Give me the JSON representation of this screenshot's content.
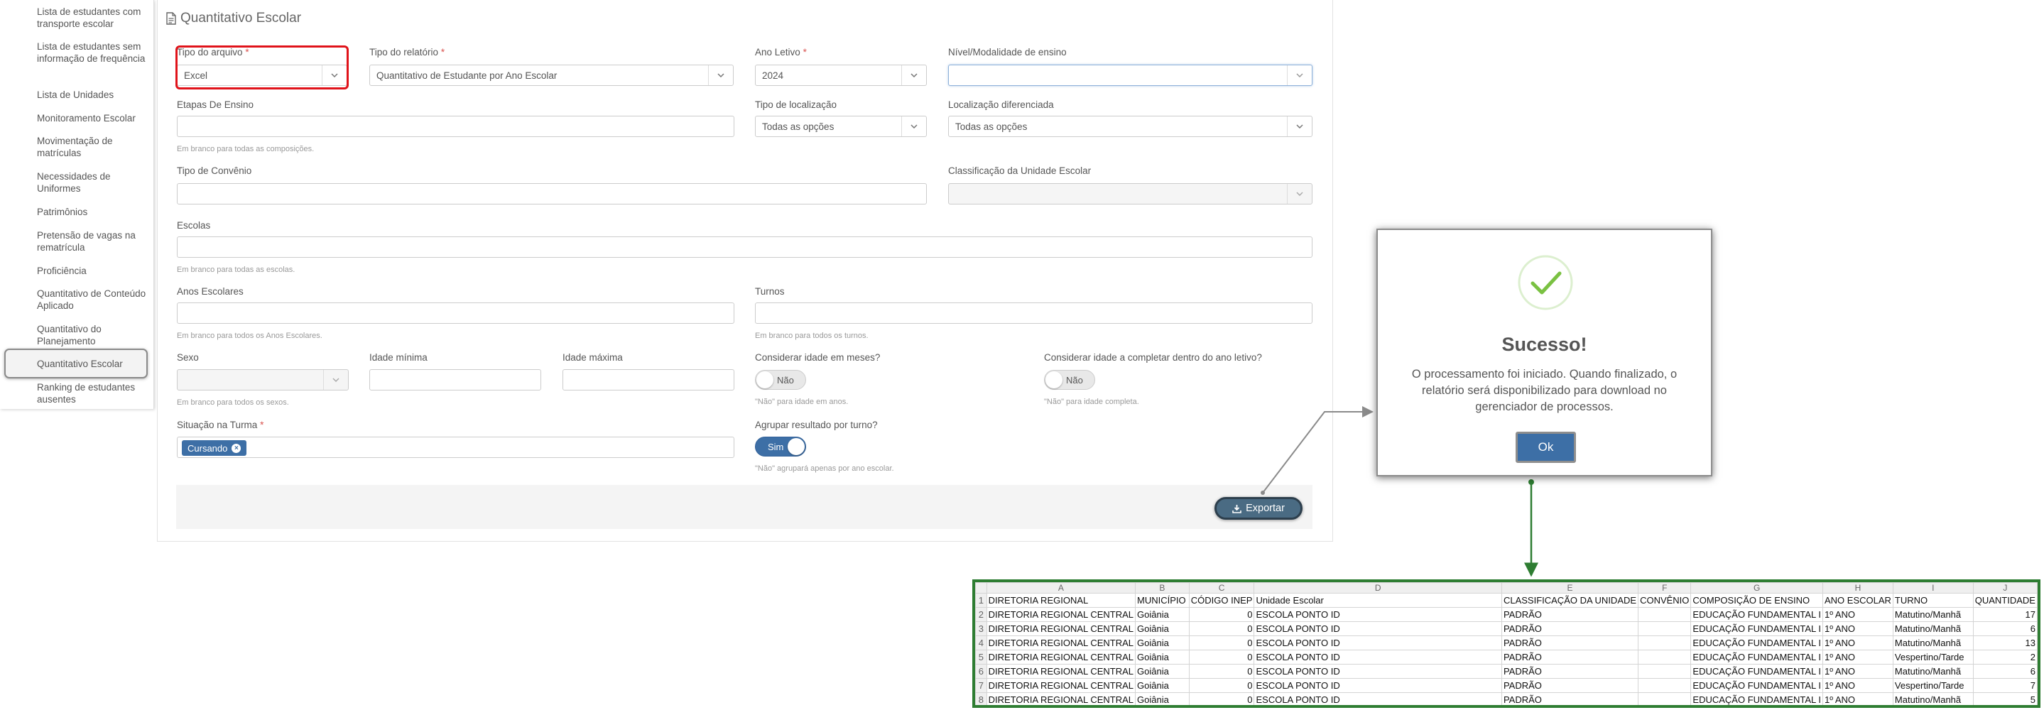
{
  "sidebar": {
    "items": [
      {
        "label": "Lista de estudantes com transporte escolar"
      },
      {
        "label": "Lista de estudantes sem informação de frequência"
      },
      {
        "label": "Lista de Unidades"
      },
      {
        "label": "Monitoramento Escolar"
      },
      {
        "label": "Movimentação de matrículas"
      },
      {
        "label": "Necessidades de Uniformes"
      },
      {
        "label": "Patrimônios"
      },
      {
        "label": "Pretensão de vagas na rematrícula"
      },
      {
        "label": "Proficiência"
      },
      {
        "label": "Quantitativo de Conteúdo Aplicado"
      },
      {
        "label": "Quantitativo do Planejamento"
      },
      {
        "label": "Quantitativo Escolar"
      },
      {
        "label": "Ranking de estudantes ausentes"
      }
    ],
    "active": "Quantitativo Escolar"
  },
  "page": {
    "title": "Quantitativo Escolar"
  },
  "form": {
    "required_mark": "*",
    "tipo_arquivo": {
      "label": "Tipo do arquivo",
      "value": "Excel"
    },
    "tipo_relatorio": {
      "label": "Tipo do relatório",
      "value": "Quantitativo de Estudante por Ano Escolar"
    },
    "ano_letivo": {
      "label": "Ano Letivo",
      "value": "2024"
    },
    "nivel": {
      "label": "Nível/Modalidade de ensino",
      "value": ""
    },
    "etapas": {
      "label": "Etapas De Ensino",
      "hint": "Em branco para todas as composições."
    },
    "tipo_localizacao": {
      "label": "Tipo de localização",
      "value": "Todas as opções"
    },
    "localizacao_diferenciada": {
      "label": "Localização diferenciada",
      "value": "Todas as opções"
    },
    "tipo_convenio": {
      "label": "Tipo de Convênio"
    },
    "classificacao": {
      "label": "Classificação da Unidade Escolar"
    },
    "escolas": {
      "label": "Escolas",
      "hint": "Em branco para todas as escolas."
    },
    "anos_escolares": {
      "label": "Anos Escolares",
      "hint": "Em branco para todos os Anos Escolares."
    },
    "turnos": {
      "label": "Turnos",
      "hint": "Em branco para todos os turnos."
    },
    "sexo": {
      "label": "Sexo",
      "hint": "Em branco para todos os sexos."
    },
    "idade_minima": {
      "label": "Idade mínima"
    },
    "idade_maxima": {
      "label": "Idade máxima"
    },
    "idade_meses": {
      "label": "Considerar idade em meses?",
      "toggle": "Não",
      "hint": "\"Não\" para idade em anos."
    },
    "idade_completar": {
      "label": "Considerar idade a completar dentro do ano letivo?",
      "toggle": "Não",
      "hint": "\"Não\" para idade completa."
    },
    "situacao": {
      "label": "Situação na Turma",
      "chip": "Cursando",
      "chip_remove": "×"
    },
    "agrupar": {
      "label": "Agrupar resultado por turno?",
      "toggle": "Sim",
      "hint": "\"Não\" agrupará apenas por ano escolar."
    },
    "export_label": "Exportar"
  },
  "modal": {
    "title": "Sucesso!",
    "message": "O processamento foi iniciado. Quando finalizado, o relatório será disponibilizado para download no gerenciador de processos.",
    "ok_label": "Ok"
  },
  "spreadsheet": {
    "columns": [
      "A",
      "B",
      "C",
      "D",
      "E",
      "F",
      "G",
      "H",
      "I",
      "J"
    ],
    "rows": [
      {
        "n": "1",
        "cells": [
          "DIRETORIA REGIONAL",
          "MUNICÍPIO",
          "CÓDIGO INEP",
          "Unidade Escolar",
          "CLASSIFICAÇÃO DA UNIDADE",
          "CONVÊNIO",
          "COMPOSIÇÃO DE ENSINO",
          "ANO ESCOLAR",
          "TURNO",
          "QUANTIDADE"
        ]
      },
      {
        "n": "2",
        "cells": [
          "DIRETORIA REGIONAL CENTRAL",
          "Goiânia",
          "0",
          "ESCOLA PONTO ID",
          "PADRÃO",
          "",
          "EDUCAÇÃO FUNDAMENTAL I",
          "1º ANO",
          "Matutino/Manhã",
          "17"
        ]
      },
      {
        "n": "3",
        "cells": [
          "DIRETORIA REGIONAL CENTRAL",
          "Goiânia",
          "0",
          "ESCOLA PONTO ID",
          "PADRÃO",
          "",
          "EDUCAÇÃO FUNDAMENTAL I",
          "1º ANO",
          "Matutino/Manhã",
          "6"
        ]
      },
      {
        "n": "4",
        "cells": [
          "DIRETORIA REGIONAL CENTRAL",
          "Goiânia",
          "0",
          "ESCOLA PONTO ID",
          "PADRÃO",
          "",
          "EDUCAÇÃO FUNDAMENTAL I",
          "1º ANO",
          "Matutino/Manhã",
          "13"
        ]
      },
      {
        "n": "5",
        "cells": [
          "DIRETORIA REGIONAL CENTRAL",
          "Goiânia",
          "0",
          "ESCOLA PONTO ID",
          "PADRÃO",
          "",
          "EDUCAÇÃO FUNDAMENTAL I",
          "1º ANO",
          "Vespertino/Tarde",
          "2"
        ]
      },
      {
        "n": "6",
        "cells": [
          "DIRETORIA REGIONAL CENTRAL",
          "Goiânia",
          "0",
          "ESCOLA PONTO ID",
          "PADRÃO",
          "",
          "EDUCAÇÃO FUNDAMENTAL I",
          "1º ANO",
          "Matutino/Manhã",
          "6"
        ]
      },
      {
        "n": "7",
        "cells": [
          "DIRETORIA REGIONAL CENTRAL",
          "Goiânia",
          "0",
          "ESCOLA PONTO ID",
          "PADRÃO",
          "",
          "EDUCAÇÃO FUNDAMENTAL I",
          "1º ANO",
          "Vespertino/Tarde",
          "7"
        ]
      },
      {
        "n": "8",
        "cells": [
          "DIRETORIA REGIONAL CENTRAL",
          "Goiânia",
          "0",
          "ESCOLA PONTO ID",
          "PADRÃO",
          "",
          "EDUCAÇÃO FUNDAMENTAL I",
          "1º ANO",
          "Matutino/Manhã",
          "5"
        ]
      }
    ]
  },
  "colors": {
    "primary": "#3d6fa6",
    "highlight": "#e0131a",
    "success": "#7ac142",
    "sheet_border": "#2e7d32"
  }
}
